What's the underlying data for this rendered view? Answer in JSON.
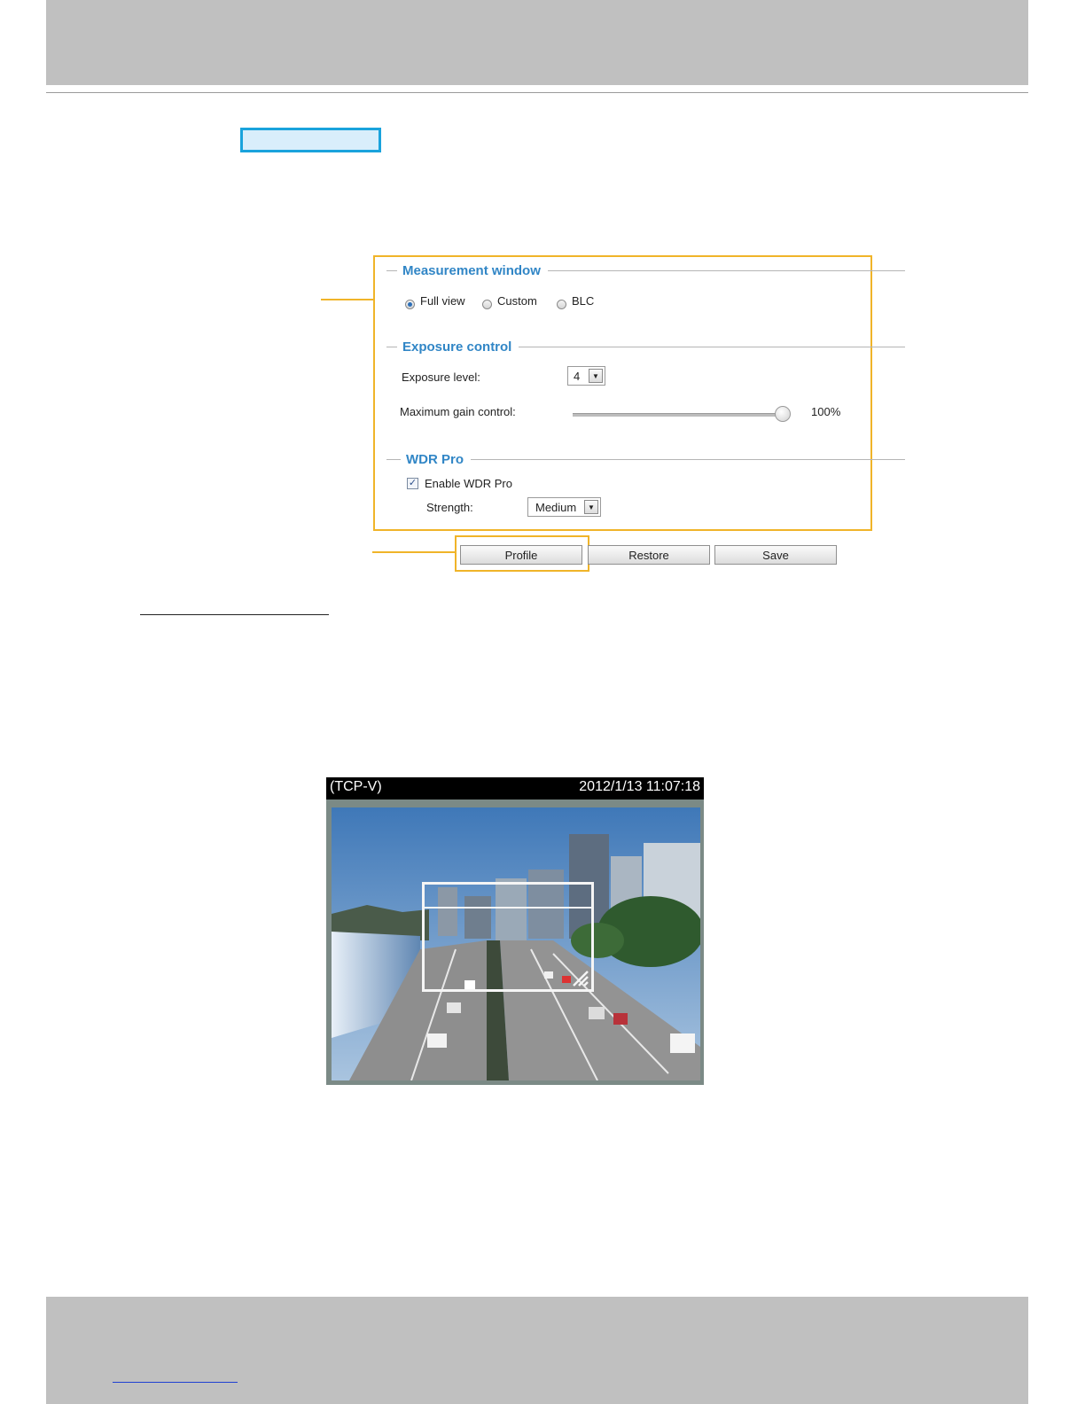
{
  "measurement": {
    "title": "Measurement window",
    "options": [
      {
        "label": "Full view",
        "selected": true
      },
      {
        "label": "Custom",
        "selected": false
      },
      {
        "label": "BLC",
        "selected": false
      }
    ]
  },
  "exposure": {
    "title": "Exposure control",
    "level_label": "Exposure level:",
    "level_value": "4",
    "gain_label": "Maximum gain control:",
    "gain_value_text": "100%",
    "gain_fraction": 1.0
  },
  "wdr": {
    "title": "WDR Pro",
    "enable_label": "Enable WDR Pro",
    "enabled": true,
    "strength_label": "Strength:",
    "strength_value": "Medium"
  },
  "buttons": {
    "profile": "Profile",
    "restore": "Restore",
    "save": "Save"
  },
  "video": {
    "protocol": "(TCP-V)",
    "timestamp": "2012/1/13 11:07:18"
  },
  "colors": {
    "highlight": "#f0b429",
    "tab_border": "#1aa3dc",
    "section_title": "#3186c6"
  }
}
